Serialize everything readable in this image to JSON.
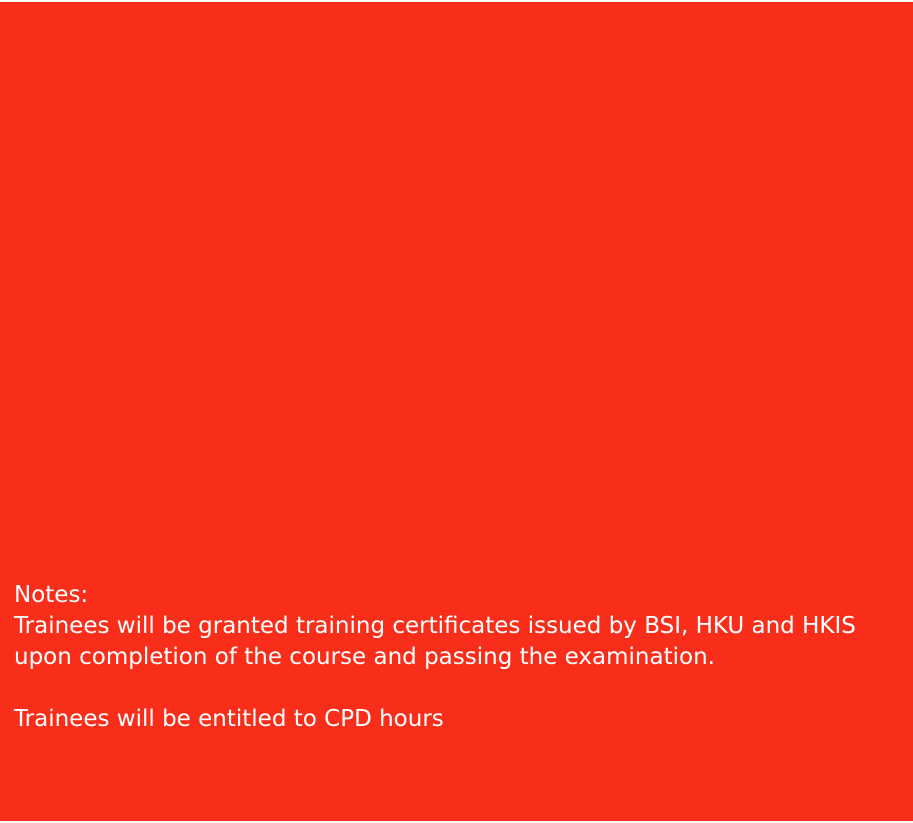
{
  "colors": {
    "panel_background": "#f92e1a",
    "text": "#ffffff",
    "page_background": "#ffffff"
  },
  "notes": {
    "heading": "Notes:",
    "paragraph_1": "Trainees will be granted training certificates issued by BSI, HKU and HKIS upon completion of the course and passing the examination.",
    "paragraph_2": "Trainees will be entitled to CPD hours"
  }
}
